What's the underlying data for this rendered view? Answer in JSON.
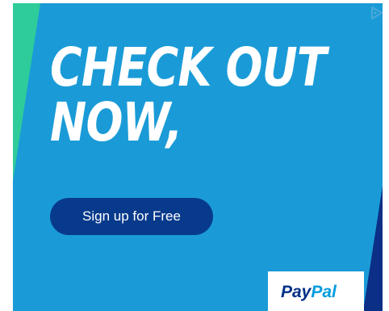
{
  "ad": {
    "headline_line1": "CHECK OUT",
    "headline_line2": "NOW,",
    "cta_label": "Sign up for Free",
    "logo": {
      "part1": "Pay",
      "part2": "Pal"
    },
    "adchoices_icon": "adchoices-triangle-icon"
  },
  "colors": {
    "background_blue": "#1a9bd7",
    "accent_green": "#2ecc9a",
    "navy": "#083a8c",
    "logo_dark": "#003087",
    "logo_light": "#009cde"
  }
}
